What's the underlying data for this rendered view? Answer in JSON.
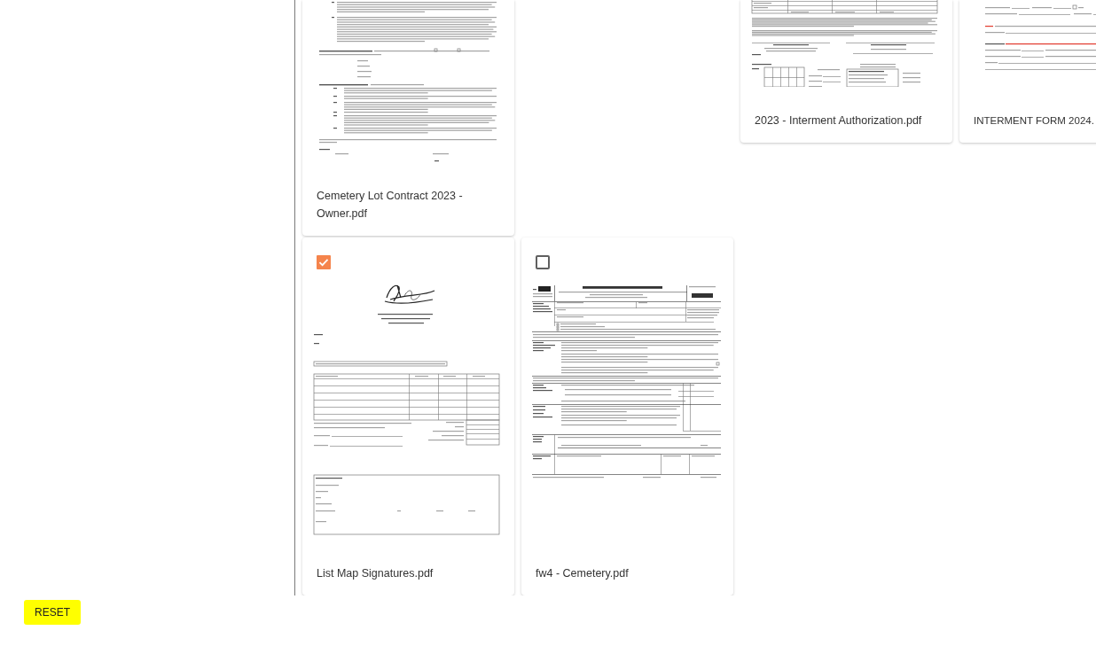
{
  "documents": [
    {
      "title": "Cemetery Lot Contract 2023 - Owner.pdf",
      "kind": "contract"
    },
    {
      "title": "2023 - Interment Authorization.pdf",
      "kind": "authorization"
    },
    {
      "title": "INTERMENT FORM 2024.",
      "kind": "interment-form"
    },
    {
      "title": "List Map Signatures.pdf",
      "kind": "invoice",
      "checked": true
    },
    {
      "title": "fw4 - Cemetery.pdf",
      "kind": "tax-form",
      "checked": false
    }
  ],
  "reset_button": {
    "label": "RESET"
  }
}
